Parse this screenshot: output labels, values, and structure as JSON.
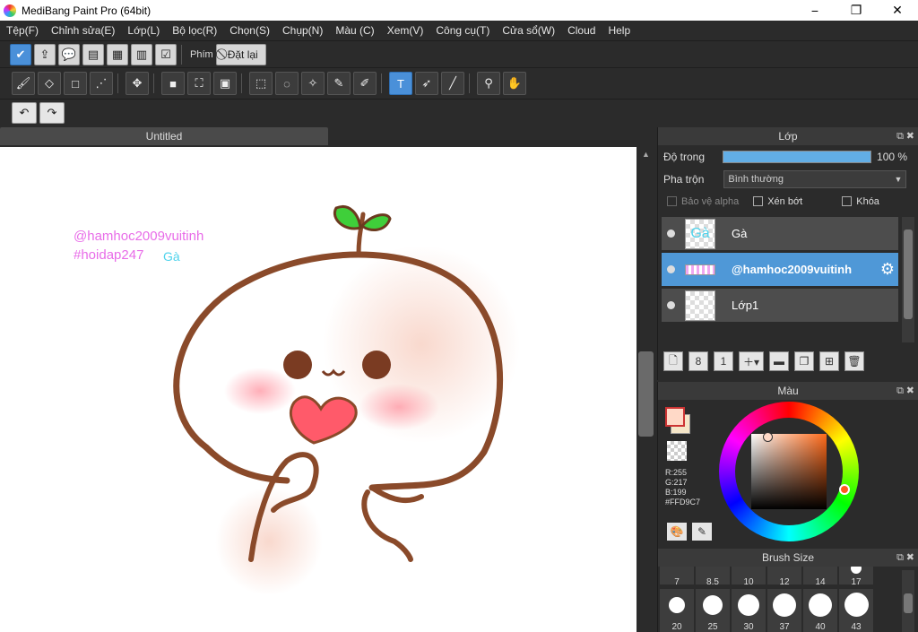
{
  "window": {
    "title": "MediBang Paint Pro (64bit)",
    "minimize": "−",
    "maximize": "❐",
    "close": "✕"
  },
  "menu": [
    "Tệp(F)",
    "Chỉnh sửa(E)",
    "Lớp(L)",
    "Bộ lọc(R)",
    "Chọn(S)",
    "Chụp(N)",
    "Màu (C)",
    "Xem(V)",
    "Công cụ(T)",
    "Cửa sổ(W)",
    "Cloud",
    "Help"
  ],
  "toolbar": {
    "key_label": "Phím",
    "reset_label": "Đặt lại",
    "active_tool": "text-tool"
  },
  "document": {
    "tab": "Untitled"
  },
  "canvas": {
    "text1": "@hamhoc2009vuitinh",
    "text2": "#hoidap247",
    "text3": "Gà",
    "text1_color": "#e86ce8",
    "text3_color": "#4fd3ec"
  },
  "layers_panel": {
    "title": "Lớp",
    "opacity_label": "Độ trong",
    "opacity_value": "100 %",
    "blend_label": "Pha trộn",
    "blend_value": "Bình thường",
    "alpha_label": "Bảo vệ alpha",
    "clip_label": "Xén bớt",
    "lock_label": "Khóa",
    "layers": [
      {
        "name": "Gà",
        "thumb": "Gà",
        "selected": false
      },
      {
        "name": "@hamhoc2009vuitinh",
        "thumb": "",
        "selected": true
      },
      {
        "name": "Lớp1",
        "thumb": "",
        "selected": false
      }
    ]
  },
  "color_panel": {
    "title": "Màu",
    "r": "R:255",
    "g": "G:217",
    "b": "B:199",
    "hex": "#FFD9C7",
    "fg": "#ffd9c7",
    "bg": "#f5e6c8"
  },
  "brush_panel": {
    "title": "Brush Size",
    "row1": [
      "7",
      "8.5",
      "10",
      "12",
      "14",
      "17"
    ],
    "row2": [
      "20",
      "25",
      "30",
      "37",
      "40",
      "43"
    ]
  }
}
